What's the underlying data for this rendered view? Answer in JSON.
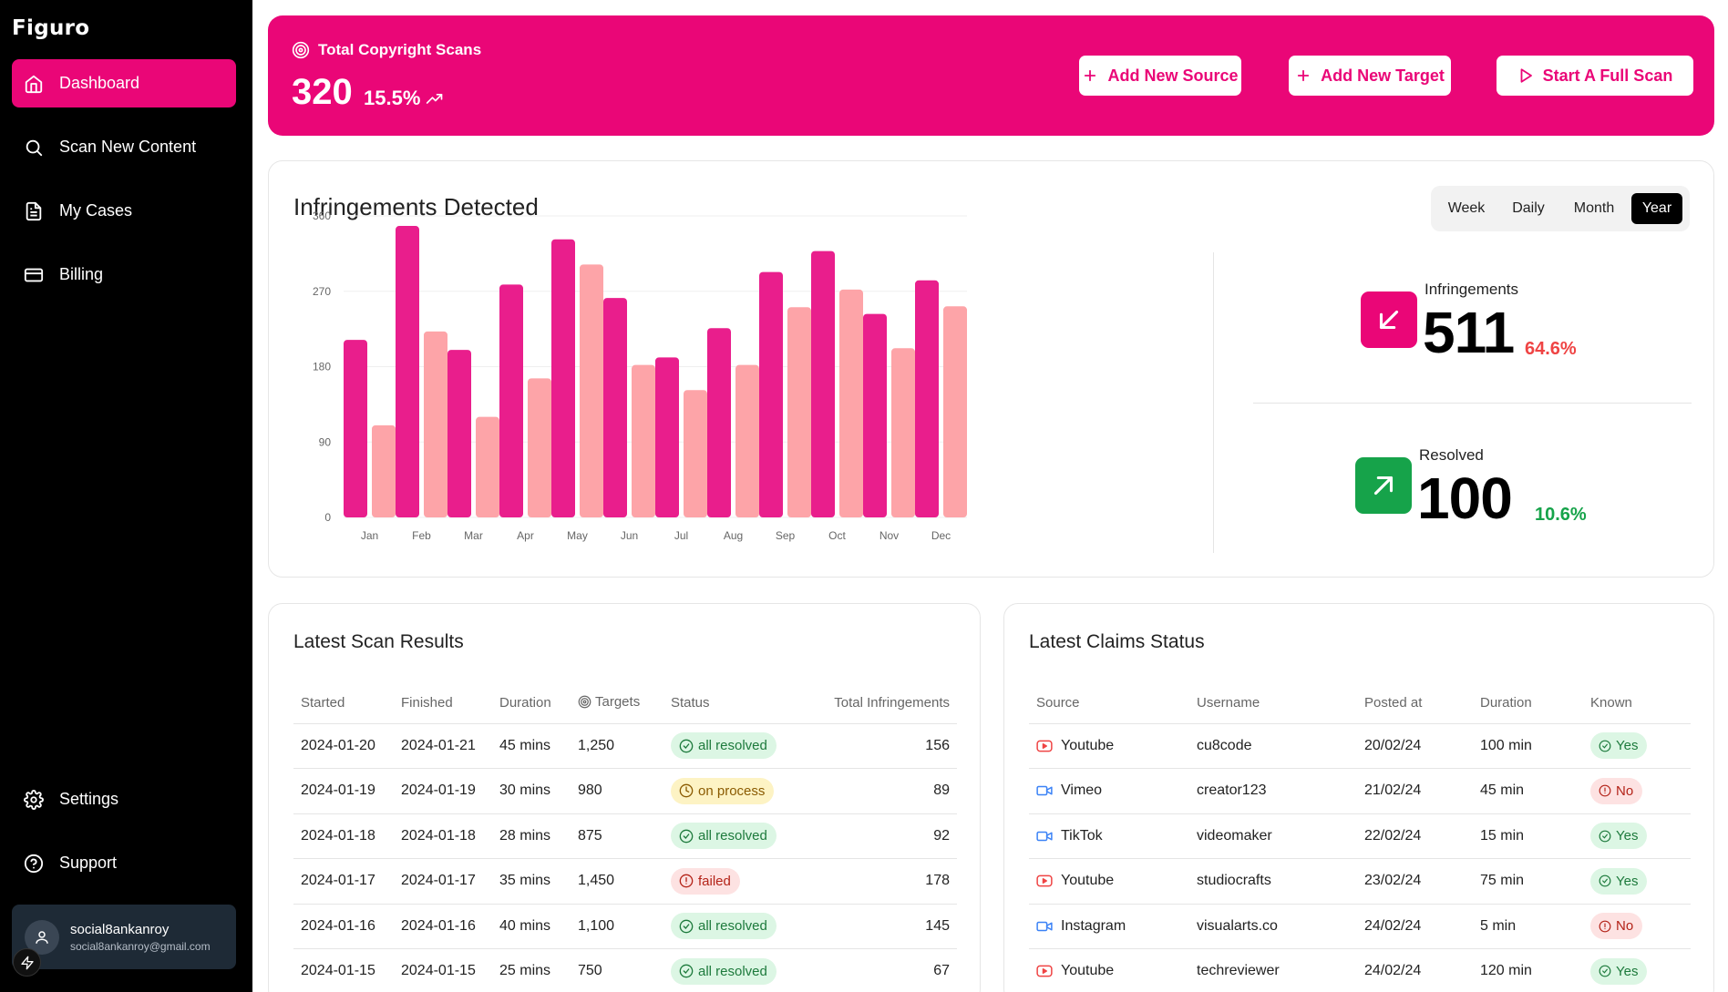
{
  "app": {
    "name": "Figuro"
  },
  "nav": {
    "dashboard": "Dashboard",
    "scan": "Scan New Content",
    "cases": "My Cases",
    "billing": "Billing",
    "settings": "Settings",
    "support": "Support"
  },
  "user": {
    "name": "social8ankanroy",
    "email": "social8ankanroy@gmail.com"
  },
  "hero": {
    "label": "Total Copyright Scans",
    "count": "320",
    "change": "15.5%",
    "buttons": {
      "add_source": "Add New Source",
      "add_target": "Add New Target",
      "full_scan": "Start A Full Scan"
    }
  },
  "infringements": {
    "title": "Infringements Detected",
    "periods": [
      "Week",
      "Daily",
      "Month",
      "Year"
    ],
    "selected_period": "Year",
    "stats": {
      "infringements_label": "Infringements",
      "infringements_value": "511",
      "infringements_change": "64.6%",
      "resolved_label": "Resolved",
      "resolved_value": "100",
      "resolved_change": "10.6%"
    }
  },
  "colors": {
    "accent": "#ea0677",
    "series_a": "#e91e8c",
    "series_b": "#fda4a8",
    "green": "#16a34a",
    "red": "#ef4444"
  },
  "chart_data": {
    "type": "bar",
    "categories": [
      "Jan",
      "Feb",
      "Mar",
      "Apr",
      "May",
      "Jun",
      "Jul",
      "Aug",
      "Sep",
      "Oct",
      "Nov",
      "Dec"
    ],
    "series": [
      {
        "values": [
          212,
          348,
          200,
          278,
          332,
          262,
          191,
          226,
          293,
          318,
          243,
          283
        ]
      },
      {
        "values": [
          110,
          222,
          120,
          166,
          302,
          182,
          152,
          182,
          251,
          272,
          202,
          252
        ]
      }
    ],
    "ylim": [
      0,
      360
    ],
    "yticks": [
      "0",
      "90",
      "180",
      "270",
      "360"
    ],
    "grid": true
  },
  "scans": {
    "title": "Latest Scan Results",
    "headers": [
      "Started",
      "Finished",
      "Duration",
      "Targets",
      "Status",
      "Total Infringements"
    ],
    "rows": [
      {
        "started": "2024-01-20",
        "finished": "2024-01-21",
        "duration": "45 mins",
        "targets": "1,250",
        "status": "all resolved",
        "kind": "resolved",
        "total": "156"
      },
      {
        "started": "2024-01-19",
        "finished": "2024-01-19",
        "duration": "30 mins",
        "targets": "980",
        "status": "on process",
        "kind": "process",
        "total": "89"
      },
      {
        "started": "2024-01-18",
        "finished": "2024-01-18",
        "duration": "28 mins",
        "targets": "875",
        "status": "all resolved",
        "kind": "resolved",
        "total": "92"
      },
      {
        "started": "2024-01-17",
        "finished": "2024-01-17",
        "duration": "35 mins",
        "targets": "1,450",
        "status": "failed",
        "kind": "failed",
        "total": "178"
      },
      {
        "started": "2024-01-16",
        "finished": "2024-01-16",
        "duration": "40 mins",
        "targets": "1,100",
        "status": "all resolved",
        "kind": "resolved",
        "total": "145"
      },
      {
        "started": "2024-01-15",
        "finished": "2024-01-15",
        "duration": "25 mins",
        "targets": "750",
        "status": "all resolved",
        "kind": "resolved",
        "total": "67"
      }
    ]
  },
  "claims": {
    "title": "Latest Claims Status",
    "headers": [
      "Source",
      "Username",
      "Posted at",
      "Duration",
      "Known"
    ],
    "rows": [
      {
        "source": "Youtube",
        "icon": "youtube-icon",
        "username": "cu8code",
        "posted": "20/02/24",
        "duration": "100 min",
        "known": "Yes"
      },
      {
        "source": "Vimeo",
        "icon": "video-icon",
        "username": "creator123",
        "posted": "21/02/24",
        "duration": "45 min",
        "known": "No"
      },
      {
        "source": "TikTok",
        "icon": "video-icon",
        "username": "videomaker",
        "posted": "22/02/24",
        "duration": "15 min",
        "known": "Yes"
      },
      {
        "source": "Youtube",
        "icon": "youtube-icon",
        "username": "studiocrafts",
        "posted": "23/02/24",
        "duration": "75 min",
        "known": "Yes"
      },
      {
        "source": "Instagram",
        "icon": "video-icon",
        "username": "visualarts.co",
        "posted": "24/02/24",
        "duration": "5 min",
        "known": "No"
      },
      {
        "source": "Youtube",
        "icon": "youtube-icon",
        "username": "techreviewer",
        "posted": "24/02/24",
        "duration": "120 min",
        "known": "Yes"
      }
    ]
  }
}
